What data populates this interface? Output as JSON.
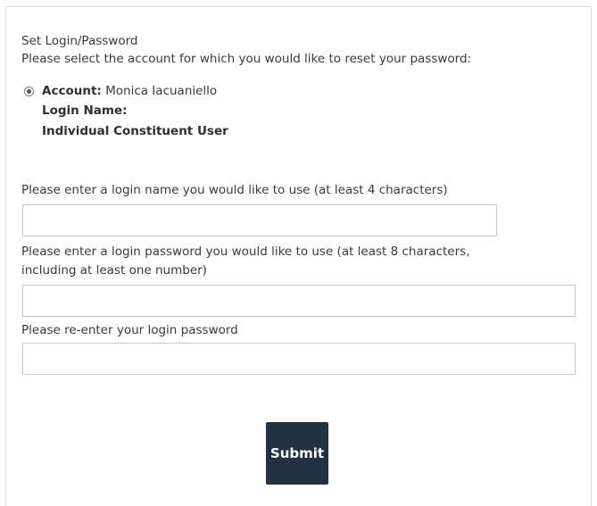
{
  "form": {
    "title": "Set Login/Password",
    "instruction": "Please select the account for which you would like to reset your password:",
    "account": {
      "label": "Account:",
      "name": "Monica Iacuaniello",
      "login_name_label": "Login Name:",
      "user_type": "Individual Constituent User",
      "selected": true
    },
    "login_name": {
      "label": "Please enter a login name you would like to use (at least 4 characters)",
      "value": ""
    },
    "password": {
      "label_line1": "Please enter a login password you would like to use (at least 8 characters,",
      "label_line2": "including at least one number)",
      "value": ""
    },
    "confirm_password": {
      "label": "Please re-enter your login password",
      "value": ""
    },
    "submit_label": "Submit"
  },
  "colors": {
    "submit_bg": "#1f3142",
    "text": "#3a3a3a",
    "border": "#c7c7c7"
  }
}
